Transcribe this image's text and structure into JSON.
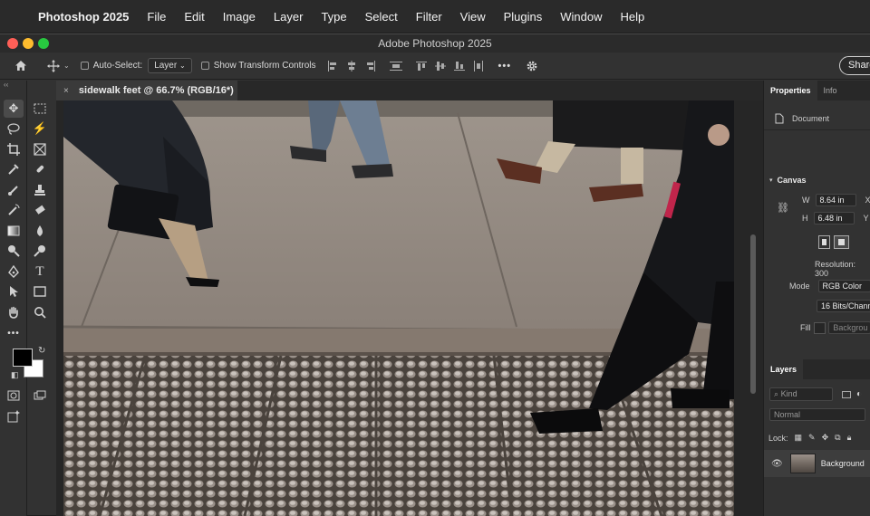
{
  "menubar": {
    "app_name": "Photoshop 2025",
    "items": [
      "File",
      "Edit",
      "Image",
      "Layer",
      "Type",
      "Select",
      "Filter",
      "View",
      "Plugins",
      "Window",
      "Help"
    ]
  },
  "window": {
    "title": "Adobe Photoshop 2025"
  },
  "options_bar": {
    "auto_select_label": "Auto-Select:",
    "auto_select_value": "Layer",
    "show_transform_label": "Show Transform Controls",
    "more": "•••",
    "share_label": "Share"
  },
  "document": {
    "tab_close": "×",
    "tab_title": "sidewalk feet @ 66.7% (RGB/16*) *"
  },
  "tools": {
    "collapse_glyph": "‹‹",
    "more": "•••",
    "foreground_color": "#000000",
    "background_color": "#ffffff"
  },
  "properties": {
    "tab_properties": "Properties",
    "tab_info": "Info",
    "document_label": "Document",
    "canvas_header": "Canvas",
    "w_label": "W",
    "w_value": "8.64 in",
    "x_label": "X",
    "h_label": "H",
    "h_value": "6.48 in",
    "y_label": "Y",
    "resolution_label": "Resolution: 300",
    "mode_label": "Mode",
    "mode_value": "RGB Color",
    "bits_value": "16 Bits/Chann",
    "fill_label": "Fill",
    "fill_value": "Backgrou"
  },
  "layers": {
    "header": "Layers",
    "kind_placeholder": "Kind",
    "blend_mode": "Normal",
    "lock_label": "Lock:",
    "layer_name": "Background"
  }
}
